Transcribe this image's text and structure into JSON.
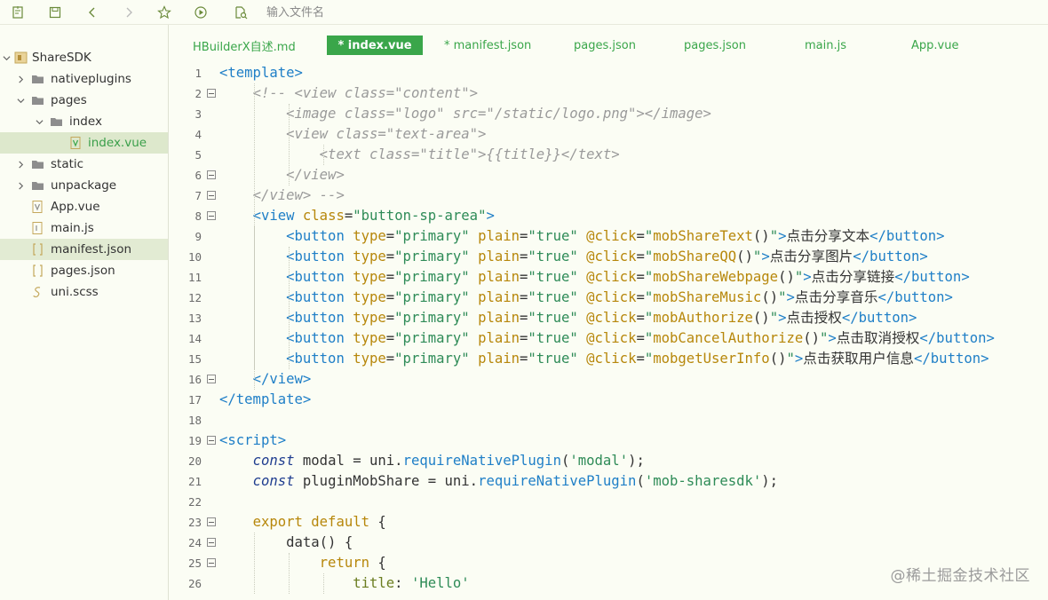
{
  "toolbar": {
    "buttons": [
      "new-file-icon",
      "save-icon",
      "back-arrow-icon",
      "forward-arrow-icon",
      "star-icon",
      "run-icon",
      "file-search-icon"
    ],
    "search_placeholder": "输入文件名"
  },
  "sidebar": {
    "project": "ShareSDK",
    "items": [
      {
        "label": "ShareSDK",
        "type": "project",
        "expanded": true
      },
      {
        "label": "nativeplugins",
        "type": "folder",
        "expanded": false
      },
      {
        "label": "pages",
        "type": "folder",
        "expanded": true
      },
      {
        "label": "index",
        "type": "folder",
        "expanded": true
      },
      {
        "label": "index.vue",
        "type": "vue-file",
        "selected": true
      },
      {
        "label": "static",
        "type": "folder",
        "expanded": false
      },
      {
        "label": "unpackage",
        "type": "folder",
        "expanded": false
      },
      {
        "label": "App.vue",
        "type": "vue-file"
      },
      {
        "label": "main.js",
        "type": "js-file"
      },
      {
        "label": "manifest.json",
        "type": "json-file",
        "highlighted": true
      },
      {
        "label": "pages.json",
        "type": "json-file"
      },
      {
        "label": "uni.scss",
        "type": "scss-file"
      }
    ]
  },
  "tabs": [
    {
      "label": "HBuilderX自述.md",
      "active": false
    },
    {
      "label": "* index.vue",
      "active": true
    },
    {
      "label": "* manifest.json",
      "active": false
    },
    {
      "label": "pages.json",
      "active": false
    },
    {
      "label": "pages.json",
      "active": false
    },
    {
      "label": "main.js",
      "active": false
    },
    {
      "label": "App.vue",
      "active": false
    }
  ],
  "editor": {
    "line_numbers": [
      "1",
      "2",
      "3",
      "4",
      "5",
      "6",
      "7",
      "8",
      "9",
      "10",
      "11",
      "12",
      "13",
      "14",
      "15",
      "16",
      "17",
      "18",
      "19",
      "20",
      "21",
      "22",
      "23",
      "24",
      "25",
      "26"
    ],
    "fold_lines": [
      "2",
      "6",
      "7",
      "8",
      "16",
      "19",
      "23",
      "24",
      "25"
    ],
    "lines": [
      [
        {
          "c": "t-tag",
          "t": "<template>"
        }
      ],
      [
        {
          "c": "t-txt",
          "t": "    "
        },
        {
          "c": "t-cm",
          "t": "<!-- <view class=\"content\">"
        }
      ],
      [
        {
          "c": "t-txt",
          "t": "        "
        },
        {
          "c": "t-cm",
          "t": "<image class=\"logo\" src=\"/static/logo.png\"></image>"
        }
      ],
      [
        {
          "c": "t-txt",
          "t": "        "
        },
        {
          "c": "t-cm",
          "t": "<view class=\"text-area\">"
        }
      ],
      [
        {
          "c": "t-txt",
          "t": "            "
        },
        {
          "c": "t-cm",
          "t": "<text class=\"title\">{{title}}</text>"
        }
      ],
      [
        {
          "c": "t-txt",
          "t": "        "
        },
        {
          "c": "t-cm",
          "t": "</view>"
        }
      ],
      [
        {
          "c": "t-txt",
          "t": "    "
        },
        {
          "c": "t-cm",
          "t": "</view> -->"
        }
      ],
      [
        {
          "c": "t-txt",
          "t": "    "
        },
        {
          "c": "t-tag",
          "t": "<view "
        },
        {
          "c": "t-attr",
          "t": "class"
        },
        {
          "c": "t-txt",
          "t": "="
        },
        {
          "c": "t-str",
          "t": "\"button-sp-area\""
        },
        {
          "c": "t-tag",
          "t": ">"
        }
      ],
      [
        {
          "c": "t-txt",
          "t": "        "
        },
        {
          "c": "t-tag",
          "t": "<button "
        },
        {
          "c": "t-attr",
          "t": "type"
        },
        {
          "c": "t-txt",
          "t": "="
        },
        {
          "c": "t-str",
          "t": "\"primary\" "
        },
        {
          "c": "t-attr",
          "t": "plain"
        },
        {
          "c": "t-txt",
          "t": "="
        },
        {
          "c": "t-str",
          "t": "\"true\" "
        },
        {
          "c": "t-attr",
          "t": "@click"
        },
        {
          "c": "t-txt",
          "t": "="
        },
        {
          "c": "t-str",
          "t": "\""
        },
        {
          "c": "t-attr",
          "t": "mobShareText"
        },
        {
          "c": "t-txt",
          "t": "()"
        },
        {
          "c": "t-str",
          "t": "\""
        },
        {
          "c": "t-tag",
          "t": ">"
        },
        {
          "c": "t-txt",
          "t": "点击分享文本"
        },
        {
          "c": "t-tag",
          "t": "</button>"
        }
      ],
      [
        {
          "c": "t-txt",
          "t": "        "
        },
        {
          "c": "t-tag",
          "t": "<button "
        },
        {
          "c": "t-attr",
          "t": "type"
        },
        {
          "c": "t-txt",
          "t": "="
        },
        {
          "c": "t-str",
          "t": "\"primary\" "
        },
        {
          "c": "t-attr",
          "t": "plain"
        },
        {
          "c": "t-txt",
          "t": "="
        },
        {
          "c": "t-str",
          "t": "\"true\" "
        },
        {
          "c": "t-attr",
          "t": "@click"
        },
        {
          "c": "t-txt",
          "t": "="
        },
        {
          "c": "t-str",
          "t": "\""
        },
        {
          "c": "t-attr",
          "t": "mobShareQQ"
        },
        {
          "c": "t-txt",
          "t": "()"
        },
        {
          "c": "t-str",
          "t": "\""
        },
        {
          "c": "t-tag",
          "t": ">"
        },
        {
          "c": "t-txt",
          "t": "点击分享图片"
        },
        {
          "c": "t-tag",
          "t": "</button>"
        }
      ],
      [
        {
          "c": "t-txt",
          "t": "        "
        },
        {
          "c": "t-tag",
          "t": "<button "
        },
        {
          "c": "t-attr",
          "t": "type"
        },
        {
          "c": "t-txt",
          "t": "="
        },
        {
          "c": "t-str",
          "t": "\"primary\" "
        },
        {
          "c": "t-attr",
          "t": "plain"
        },
        {
          "c": "t-txt",
          "t": "="
        },
        {
          "c": "t-str",
          "t": "\"true\" "
        },
        {
          "c": "t-attr",
          "t": "@click"
        },
        {
          "c": "t-txt",
          "t": "="
        },
        {
          "c": "t-str",
          "t": "\""
        },
        {
          "c": "t-attr",
          "t": "mobShareWebpage"
        },
        {
          "c": "t-txt",
          "t": "()"
        },
        {
          "c": "t-str",
          "t": "\""
        },
        {
          "c": "t-tag",
          "t": ">"
        },
        {
          "c": "t-txt",
          "t": "点击分享链接"
        },
        {
          "c": "t-tag",
          "t": "</button>"
        }
      ],
      [
        {
          "c": "t-txt",
          "t": "        "
        },
        {
          "c": "t-tag",
          "t": "<button "
        },
        {
          "c": "t-attr",
          "t": "type"
        },
        {
          "c": "t-txt",
          "t": "="
        },
        {
          "c": "t-str",
          "t": "\"primary\" "
        },
        {
          "c": "t-attr",
          "t": "plain"
        },
        {
          "c": "t-txt",
          "t": "="
        },
        {
          "c": "t-str",
          "t": "\"true\" "
        },
        {
          "c": "t-attr",
          "t": "@click"
        },
        {
          "c": "t-txt",
          "t": "="
        },
        {
          "c": "t-str",
          "t": "\""
        },
        {
          "c": "t-attr",
          "t": "mobShareMusic"
        },
        {
          "c": "t-txt",
          "t": "()"
        },
        {
          "c": "t-str",
          "t": "\""
        },
        {
          "c": "t-tag",
          "t": ">"
        },
        {
          "c": "t-txt",
          "t": "点击分享音乐"
        },
        {
          "c": "t-tag",
          "t": "</button>"
        }
      ],
      [
        {
          "c": "t-txt",
          "t": "        "
        },
        {
          "c": "t-tag",
          "t": "<button "
        },
        {
          "c": "t-attr",
          "t": "type"
        },
        {
          "c": "t-txt",
          "t": "="
        },
        {
          "c": "t-str",
          "t": "\"primary\" "
        },
        {
          "c": "t-attr",
          "t": "plain"
        },
        {
          "c": "t-txt",
          "t": "="
        },
        {
          "c": "t-str",
          "t": "\"true\" "
        },
        {
          "c": "t-attr",
          "t": "@click"
        },
        {
          "c": "t-txt",
          "t": "="
        },
        {
          "c": "t-str",
          "t": "\""
        },
        {
          "c": "t-attr",
          "t": "mobAuthorize"
        },
        {
          "c": "t-txt",
          "t": "()"
        },
        {
          "c": "t-str",
          "t": "\""
        },
        {
          "c": "t-tag",
          "t": ">"
        },
        {
          "c": "t-txt",
          "t": "点击授权"
        },
        {
          "c": "t-tag",
          "t": "</button>"
        }
      ],
      [
        {
          "c": "t-txt",
          "t": "        "
        },
        {
          "c": "t-tag",
          "t": "<button "
        },
        {
          "c": "t-attr",
          "t": "type"
        },
        {
          "c": "t-txt",
          "t": "="
        },
        {
          "c": "t-str",
          "t": "\"primary\" "
        },
        {
          "c": "t-attr",
          "t": "plain"
        },
        {
          "c": "t-txt",
          "t": "="
        },
        {
          "c": "t-str",
          "t": "\"true\" "
        },
        {
          "c": "t-attr",
          "t": "@click"
        },
        {
          "c": "t-txt",
          "t": "="
        },
        {
          "c": "t-str",
          "t": "\""
        },
        {
          "c": "t-attr",
          "t": "mobCancelAuthorize"
        },
        {
          "c": "t-txt",
          "t": "()"
        },
        {
          "c": "t-str",
          "t": "\""
        },
        {
          "c": "t-tag",
          "t": ">"
        },
        {
          "c": "t-txt",
          "t": "点击取消授权"
        },
        {
          "c": "t-tag",
          "t": "</button>"
        }
      ],
      [
        {
          "c": "t-txt",
          "t": "        "
        },
        {
          "c": "t-tag",
          "t": "<button "
        },
        {
          "c": "t-attr",
          "t": "type"
        },
        {
          "c": "t-txt",
          "t": "="
        },
        {
          "c": "t-str",
          "t": "\"primary\" "
        },
        {
          "c": "t-attr",
          "t": "plain"
        },
        {
          "c": "t-txt",
          "t": "="
        },
        {
          "c": "t-str",
          "t": "\"true\" "
        },
        {
          "c": "t-attr",
          "t": "@click"
        },
        {
          "c": "t-txt",
          "t": "="
        },
        {
          "c": "t-str",
          "t": "\""
        },
        {
          "c": "t-attr",
          "t": "mobgetUserInfo"
        },
        {
          "c": "t-txt",
          "t": "()"
        },
        {
          "c": "t-str",
          "t": "\""
        },
        {
          "c": "t-tag",
          "t": ">"
        },
        {
          "c": "t-txt",
          "t": "点击获取用户信息"
        },
        {
          "c": "t-tag",
          "t": "</button>"
        }
      ],
      [
        {
          "c": "t-txt",
          "t": "    "
        },
        {
          "c": "t-tag",
          "t": "</view>"
        }
      ],
      [
        {
          "c": "t-tag",
          "t": "</template>"
        }
      ],
      [
        {
          "c": "t-txt",
          "t": ""
        }
      ],
      [
        {
          "c": "t-tag",
          "t": "<script>"
        }
      ],
      [
        {
          "c": "t-txt",
          "t": "    "
        },
        {
          "c": "t-kwi",
          "t": "const"
        },
        {
          "c": "t-txt",
          "t": " modal = uni."
        },
        {
          "c": "t-fn",
          "t": "requireNativePlugin"
        },
        {
          "c": "t-txt",
          "t": "("
        },
        {
          "c": "t-str",
          "t": "'modal'"
        },
        {
          "c": "t-txt",
          "t": ");"
        }
      ],
      [
        {
          "c": "t-txt",
          "t": "    "
        },
        {
          "c": "t-kwi",
          "t": "const"
        },
        {
          "c": "t-txt",
          "t": " pluginMobShare = uni."
        },
        {
          "c": "t-fn",
          "t": "requireNativePlugin"
        },
        {
          "c": "t-txt",
          "t": "("
        },
        {
          "c": "t-str",
          "t": "'mob-sharesdk'"
        },
        {
          "c": "t-txt",
          "t": ");"
        }
      ],
      [
        {
          "c": "t-txt",
          "t": ""
        }
      ],
      [
        {
          "c": "t-txt",
          "t": "    "
        },
        {
          "c": "t-kw",
          "t": "export default"
        },
        {
          "c": "t-txt",
          "t": " {"
        }
      ],
      [
        {
          "c": "t-txt",
          "t": "        data() {"
        }
      ],
      [
        {
          "c": "t-txt",
          "t": "            "
        },
        {
          "c": "t-kw",
          "t": "return"
        },
        {
          "c": "t-txt",
          "t": " {"
        }
      ],
      [
        {
          "c": "t-txt",
          "t": "                "
        },
        {
          "c": "t-prop",
          "t": "title"
        },
        {
          "c": "t-txt",
          "t": ": "
        },
        {
          "c": "t-str",
          "t": "'Hello'"
        }
      ]
    ]
  },
  "watermark": "@稀土掘金技术社区"
}
